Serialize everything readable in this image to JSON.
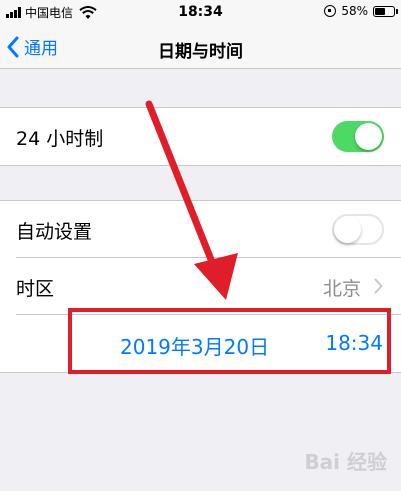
{
  "status_bar": {
    "carrier": "中国电信",
    "time": "18:34",
    "battery_percent": "58%",
    "battery_level": 0.58
  },
  "nav": {
    "back_label": "通用",
    "title": "日期与时间"
  },
  "settings": {
    "hour24": {
      "label": "24 小时制",
      "enabled": true
    },
    "auto_set": {
      "label": "自动设置",
      "enabled": false
    },
    "time_zone": {
      "label": "时区",
      "value": "北京"
    },
    "date_time": {
      "date": "2019年3月20日",
      "time": "18:34"
    }
  },
  "colors": {
    "accent": "#007aff",
    "switch_on": "#4cd964",
    "annotation": "#e01e2a"
  },
  "watermark": "Bai 经验"
}
